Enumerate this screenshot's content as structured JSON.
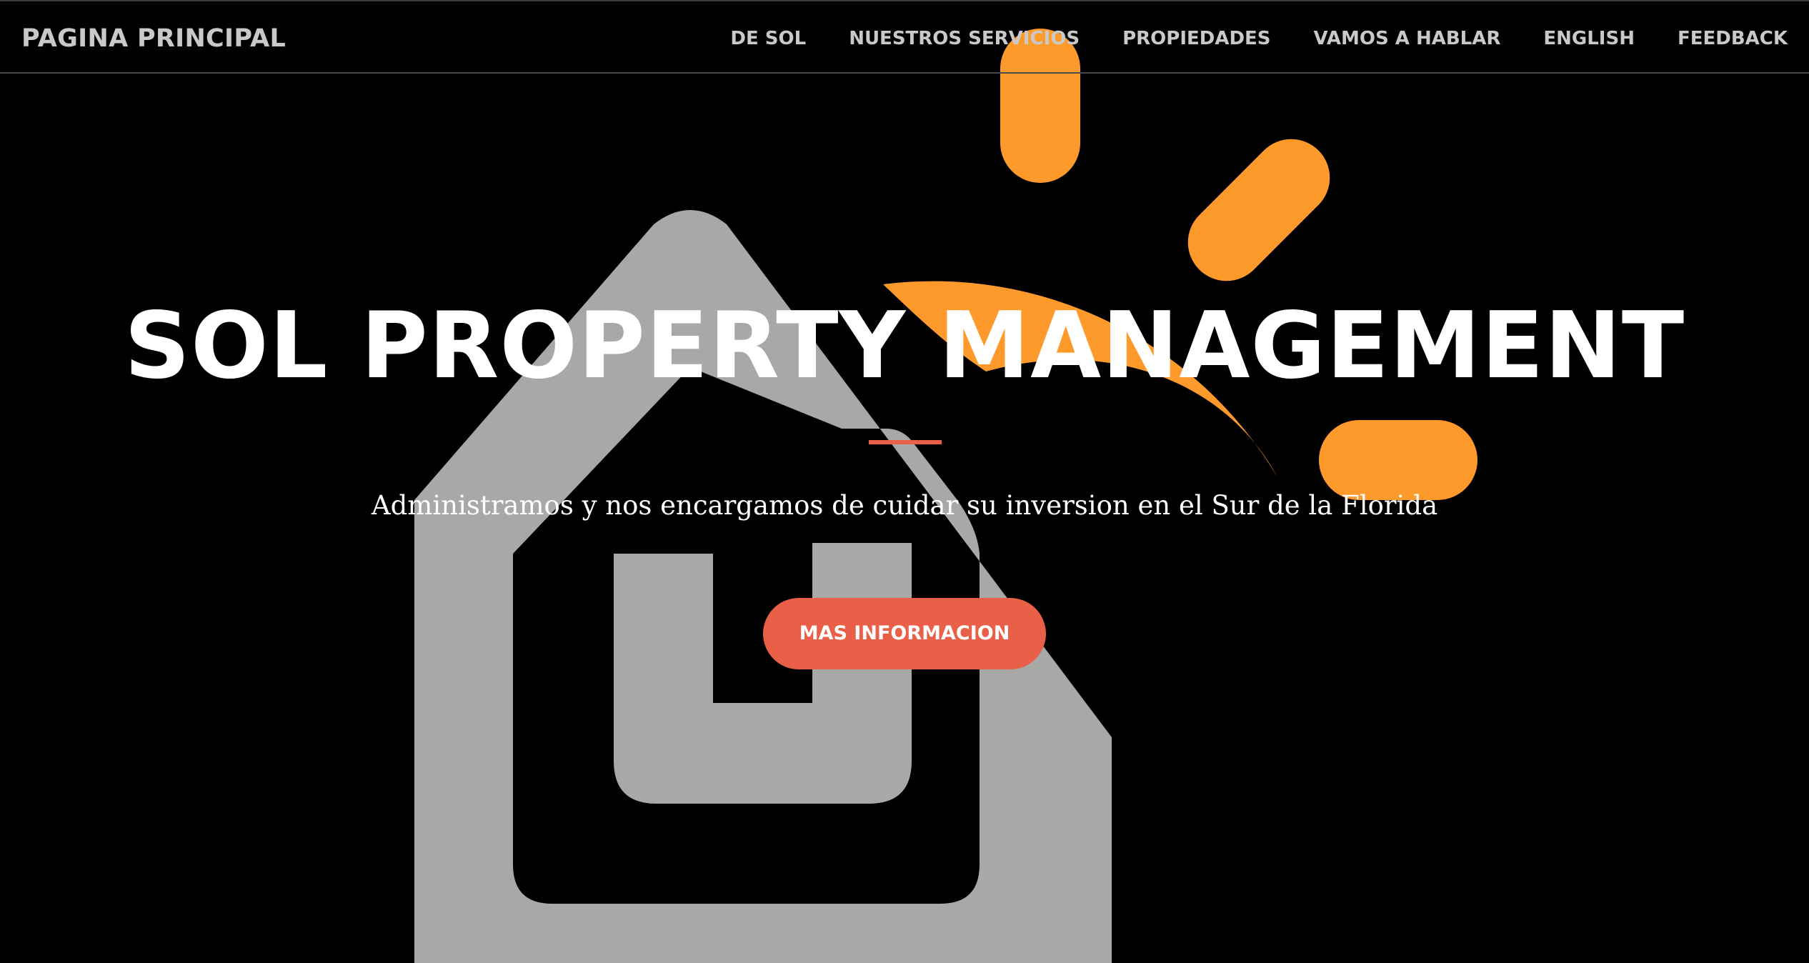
{
  "navbar": {
    "brand": "PAGINA PRINCIPAL",
    "links": [
      {
        "label": "DE SOL"
      },
      {
        "label": "NUESTROS SERVICIOS"
      },
      {
        "label": "PROPIEDADES"
      },
      {
        "label": "VAMOS A HABLAR"
      },
      {
        "label": "ENGLISH"
      },
      {
        "label": "FEEDBACK"
      }
    ]
  },
  "hero": {
    "title": "SOL PROPERTY MANAGEMENT",
    "subtitle": "Administramos y nos encargamos de cuidar su inversion en el Sur de la Florida",
    "button_label": "MAS INFORMACION"
  },
  "colors": {
    "background": "#000000",
    "nav_text": "#c9c9c9",
    "accent": "#ea5f47",
    "sun_orange": "#fe9a2b",
    "house_gray": "#a8a8a6",
    "text_white": "#ffffff"
  },
  "icons": {
    "logo": "sol-house-sun-logo"
  }
}
